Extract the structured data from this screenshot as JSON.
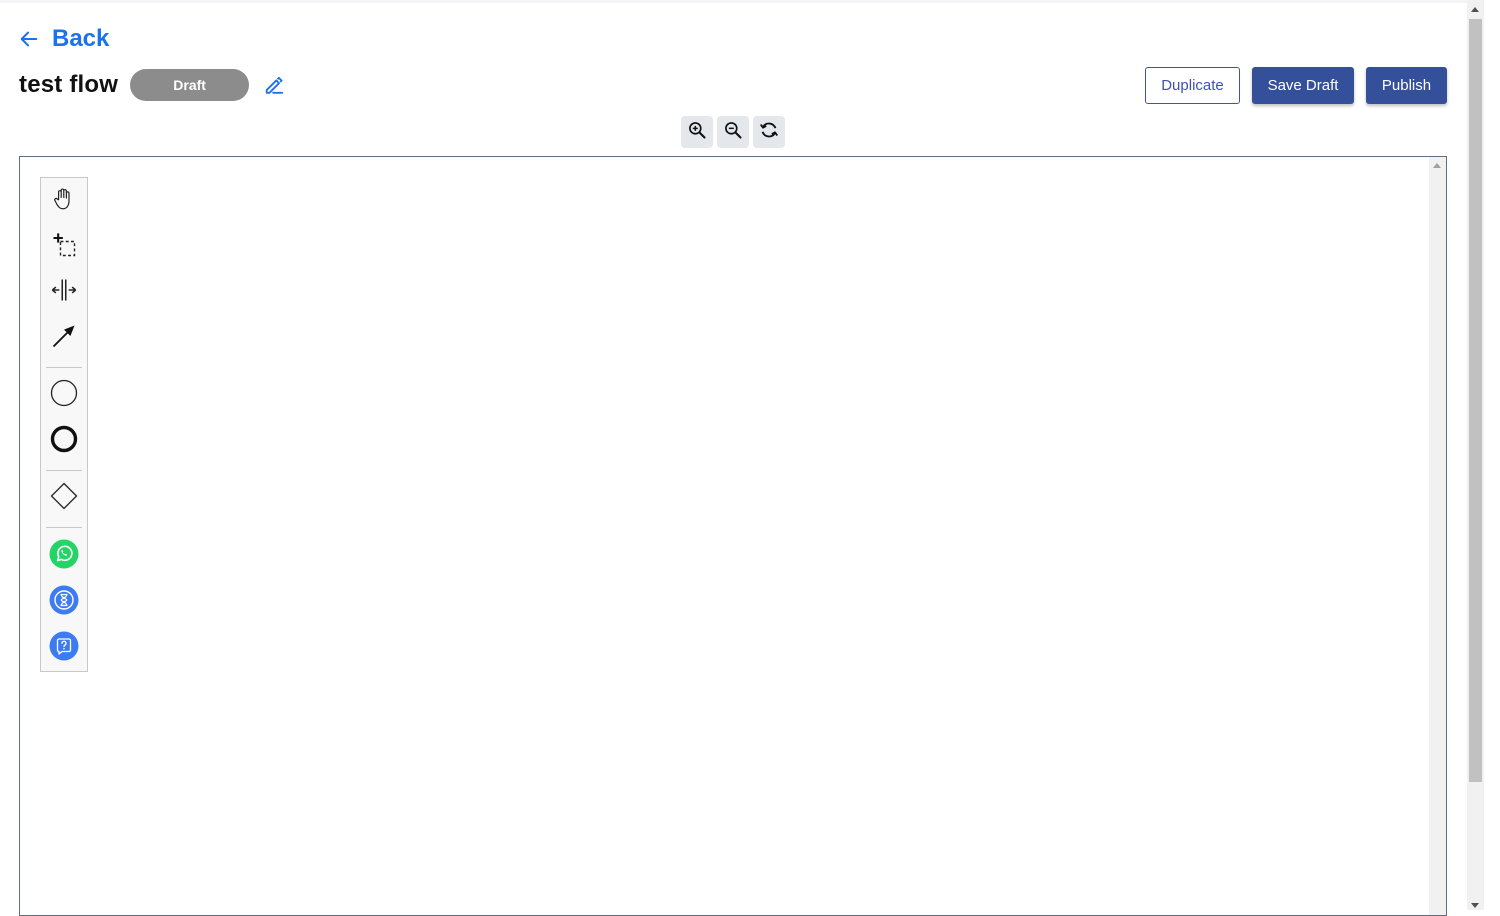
{
  "nav": {
    "back_label": "Back"
  },
  "flow": {
    "title": "test flow",
    "status": "Draft"
  },
  "actions": {
    "duplicate_label": "Duplicate",
    "save_draft_label": "Save Draft",
    "publish_label": "Publish"
  },
  "zoom_controls": [
    "zoom-in-icon",
    "zoom-out-icon",
    "reset-zoom-icon"
  ],
  "palette": {
    "tools": [
      "hand-tool-icon",
      "lasso-tool-icon",
      "space-tool-icon",
      "connect-tool-icon",
      "start-event-icon",
      "end-event-icon",
      "gateway-icon",
      "whatsapp-icon",
      "timer-icon",
      "question-icon"
    ]
  },
  "colors": {
    "link": "#1a73e8",
    "primary": "#35509b",
    "outline": "#3f51b5",
    "draft_badge": "#8c8c8c",
    "whatsapp": "#25d366",
    "node_blue": "#3d7cf0"
  }
}
